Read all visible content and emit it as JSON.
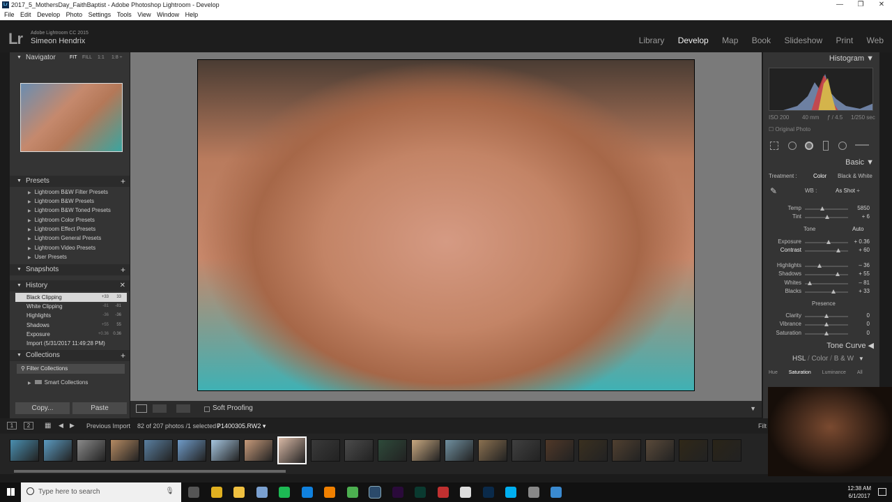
{
  "window": {
    "title": "2017_5_MothersDay_FaithBaptist - Adobe Photoshop Lightroom - Develop",
    "minimize": "—",
    "restore": "❐",
    "close": "✕"
  },
  "menu": [
    "File",
    "Edit",
    "Develop",
    "Photo",
    "Settings",
    "Tools",
    "View",
    "Window",
    "Help"
  ],
  "header": {
    "logo": "Lr",
    "version": "Adobe Lightroom CC 2015",
    "user": "Simeon Hendrix",
    "modules": [
      "Library",
      "Develop",
      "Map",
      "Book",
      "Slideshow",
      "Print",
      "Web"
    ],
    "active_module": "Develop"
  },
  "left": {
    "navigator": {
      "title": "Navigator",
      "fit": "FIT",
      "fill": "FILL",
      "one": "1:1",
      "ratio": "1:8 ÷"
    },
    "presets": {
      "title": "Presets",
      "items": [
        "Lightroom B&W Filter Presets",
        "Lightroom B&W Presets",
        "Lightroom B&W Toned Presets",
        "Lightroom Color Presets",
        "Lightroom Effect Presets",
        "Lightroom General Presets",
        "Lightroom Video Presets",
        "User Presets"
      ]
    },
    "snapshots": {
      "title": "Snapshots"
    },
    "history": {
      "title": "History",
      "items": [
        {
          "name": "Black Clipping",
          "v1": "+33",
          "v2": "33"
        },
        {
          "name": "White Clipping",
          "v1": "-81",
          "v2": "-81"
        },
        {
          "name": "Highlights",
          "v1": "-36",
          "v2": "-36"
        },
        {
          "name": "Shadows",
          "v1": "+55",
          "v2": "55"
        },
        {
          "name": "Exposure",
          "v1": "+0.36",
          "v2": "0.36"
        },
        {
          "name": "Import (5/31/2017 11:49:28 PM)",
          "v1": "",
          "v2": ""
        }
      ]
    },
    "collections": {
      "title": "Collections",
      "filter": "Filter Collections",
      "smart": "Smart Collections"
    },
    "copy": "Copy...",
    "paste": "Paste"
  },
  "toolbar": {
    "soft_proofing": "Soft Proofing"
  },
  "right": {
    "histogram": {
      "title": "Histogram",
      "iso": "ISO 200",
      "focal": "40 mm",
      "fstop": "ƒ / 4.5",
      "shutter": "1/250 sec",
      "original": "Original Photo"
    },
    "basic": {
      "title": "Basic",
      "treatment": "Treatment :",
      "color": "Color",
      "bw": "Black & White",
      "wb": "WB :",
      "wb_value": "As Shot ÷",
      "tone": "Tone",
      "auto": "Auto",
      "presence": "Presence",
      "sliders": [
        {
          "label": "Temp",
          "value": "5850",
          "pos": 0.4
        },
        {
          "label": "Tint",
          "value": "+ 6",
          "pos": 0.52
        },
        {
          "label": "Exposure",
          "value": "+ 0.36",
          "pos": 0.55
        },
        {
          "label": "Contrast",
          "value": "+ 60",
          "pos": 0.78
        },
        {
          "label": "Highlights",
          "value": "– 36",
          "pos": 0.34
        },
        {
          "label": "Shadows",
          "value": "+ 55",
          "pos": 0.76
        },
        {
          "label": "Whites",
          "value": "– 81",
          "pos": 0.12
        },
        {
          "label": "Blacks",
          "value": "+ 33",
          "pos": 0.66
        },
        {
          "label": "Clarity",
          "value": "0",
          "pos": 0.5
        },
        {
          "label": "Vibrance",
          "value": "0",
          "pos": 0.5
        },
        {
          "label": "Saturation",
          "value": "0",
          "pos": 0.5
        }
      ]
    },
    "tone_curve": "Tone Curve",
    "hsl": {
      "hsl": "HSL",
      "color": "Color",
      "bw": "B & W",
      "hue": "Hue",
      "saturation": "Saturation",
      "luminance": "Luminance",
      "all": "All"
    }
  },
  "filmstrip": {
    "prev_import": "Previous Import",
    "count": "82 of 207 photos /1 selected /",
    "filename": "P1400305.RW2 ▾",
    "filter": "Filt"
  },
  "taskbar": {
    "search_placeholder": "Type here to search",
    "time": "12:38 AM",
    "date": "6/1/2017"
  }
}
